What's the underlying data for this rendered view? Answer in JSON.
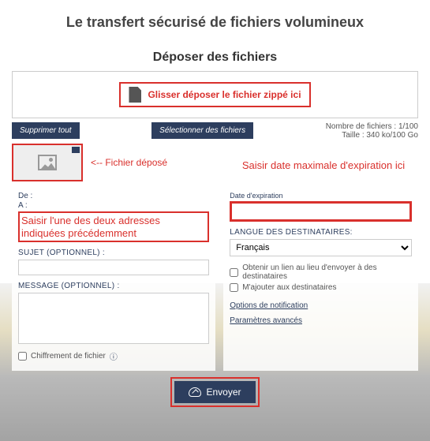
{
  "header": {
    "main_title": "Le transfert sécurisé de fichiers volumineux",
    "sub_title": "Déposer des fichiers"
  },
  "dropzone": {
    "annotation": "Glisser déposer le fichier zippé ici"
  },
  "toolbar": {
    "delete_all": "Supprimer tout",
    "select_files": "Sélectionner des fichiers",
    "file_count_label": "Nombre de fichiers : 1/100",
    "size_label": "Taille : 340 ko/100 Go"
  },
  "file_tile": {
    "deposited_label": "<-- Fichier déposé"
  },
  "form": {
    "from_label": "De :",
    "to_label": "A :",
    "address_annotation": "Saisir l'une des deux adresses indiquées précédemment",
    "subject_label": "Sujet (optionnel) :",
    "subject_value": "",
    "message_label": "Message (optionnel) :",
    "message_value": "",
    "encrypt_label": "Chiffrement de fichier"
  },
  "right": {
    "date_annotation": "Saisir date maximale d'expiration ici",
    "date_label": "Date d'expiration",
    "lang_label": "Langue des destinataires:",
    "lang_value": "Français",
    "opt_link": "Obtenir un lien au lieu d'envoyer à des destinataires",
    "opt_addme": "M'ajouter aux destinataires",
    "link_notif": "Options de notification",
    "link_adv": "Paramètres avancés"
  },
  "footer": {
    "send": "Envoyer"
  }
}
